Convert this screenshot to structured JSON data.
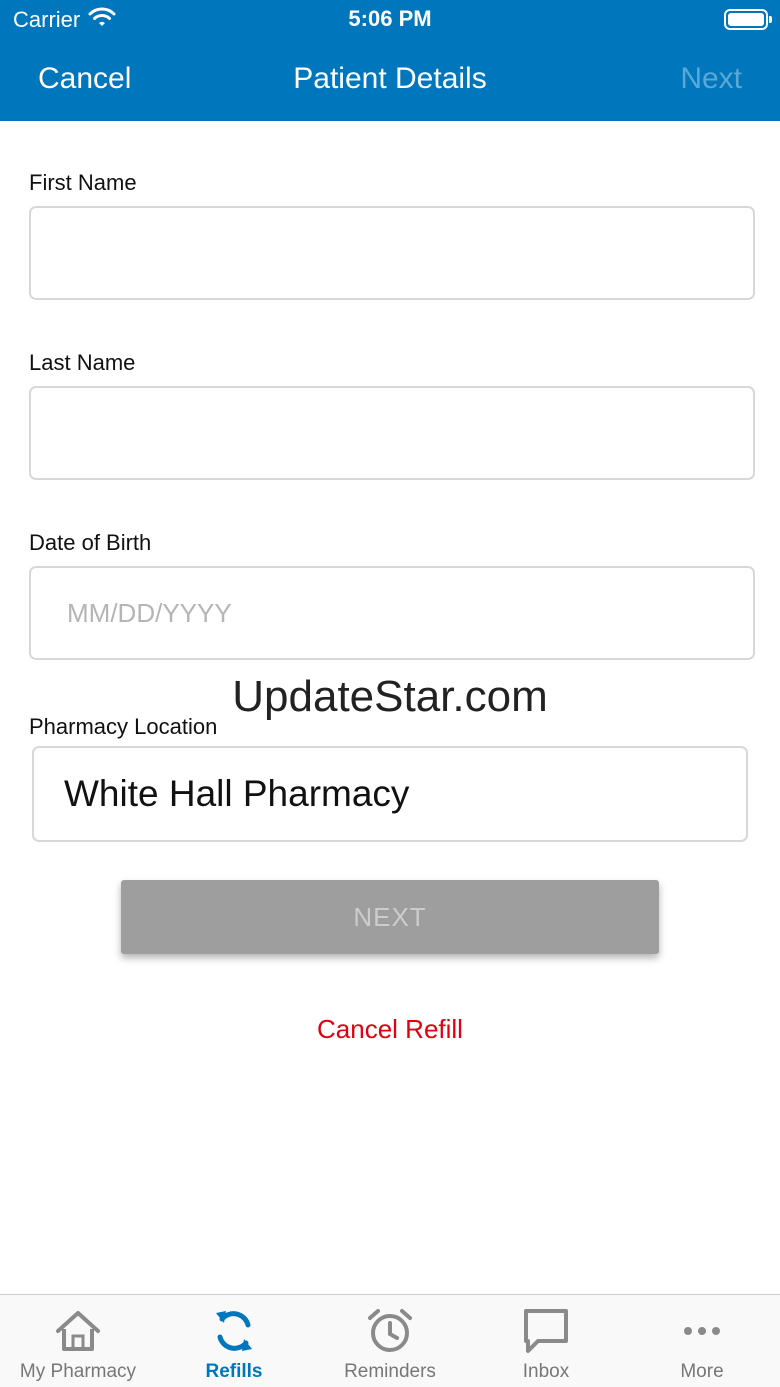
{
  "status_bar": {
    "carrier": "Carrier",
    "time": "5:06 PM"
  },
  "nav": {
    "cancel": "Cancel",
    "title": "Patient Details",
    "next": "Next"
  },
  "form": {
    "first_name": {
      "label": "First Name",
      "value": "",
      "placeholder": ""
    },
    "last_name": {
      "label": "Last Name",
      "value": "",
      "placeholder": ""
    },
    "dob": {
      "label": "Date of Birth",
      "value": "",
      "placeholder": "MM/DD/YYYY"
    },
    "pharmacy": {
      "label": "Pharmacy Location",
      "value": "White Hall Pharmacy"
    }
  },
  "watermark": "UpdateStar.com",
  "actions": {
    "next": "NEXT",
    "cancel_refill": "Cancel Refill"
  },
  "tabs": [
    {
      "label": "My Pharmacy",
      "icon": "home-icon"
    },
    {
      "label": "Refills",
      "icon": "refresh-icon",
      "active": true
    },
    {
      "label": "Reminders",
      "icon": "alarm-clock-icon"
    },
    {
      "label": "Inbox",
      "icon": "chat-bubble-icon"
    },
    {
      "label": "More",
      "icon": "more-dots-icon"
    }
  ],
  "colors": {
    "brand": "#0076bd",
    "danger": "#e0000f",
    "disabled_button": "#9e9e9e"
  }
}
